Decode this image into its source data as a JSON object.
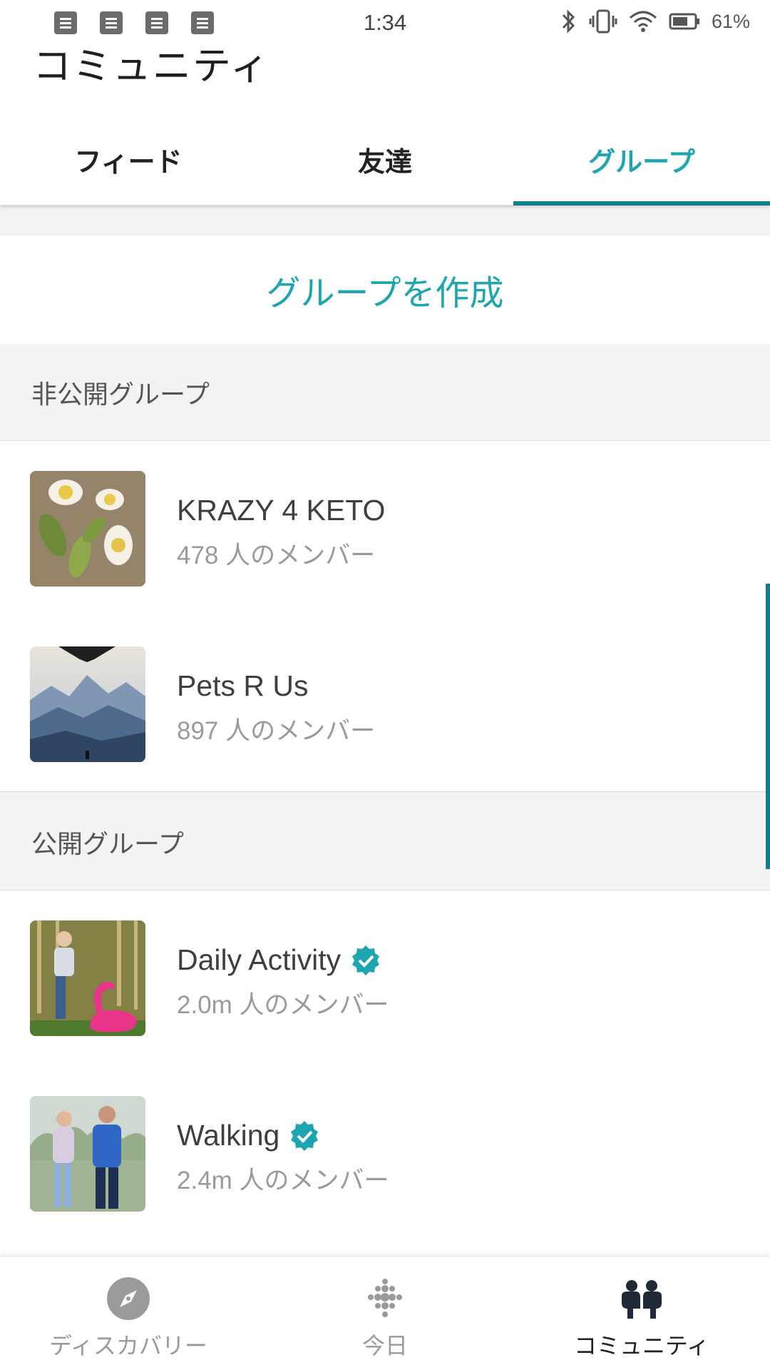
{
  "status_bar": {
    "time": "1:34",
    "battery_percent": "61%",
    "notification_icons": [
      "notification-icon",
      "notification-icon",
      "notification-icon",
      "notification-icon"
    ],
    "system_icons": [
      "bluetooth-icon",
      "vibrate-icon",
      "wifi-icon",
      "battery-icon"
    ]
  },
  "header": {
    "title": "コミュニティ"
  },
  "tabs": [
    {
      "label": "フィード",
      "active": false
    },
    {
      "label": "友達",
      "active": false
    },
    {
      "label": "グループ",
      "active": true
    }
  ],
  "create_group": {
    "label": "グループを作成"
  },
  "private_groups": {
    "header": "非公開グループ",
    "items": [
      {
        "name": "KRAZY 4 KETO",
        "members": "478 人のメンバー",
        "verified": false,
        "thumb": "food-photo"
      },
      {
        "name": "Pets R Us",
        "members": "897 人のメンバー",
        "verified": false,
        "thumb": "mountain-photo"
      }
    ]
  },
  "public_groups": {
    "header": "公開グループ",
    "items": [
      {
        "name": "Daily Activity",
        "members": "2.0m 人のメンバー",
        "verified": true,
        "thumb": "yoga-flamingo-photo"
      },
      {
        "name": "Walking",
        "members": "2.4m 人のメンバー",
        "verified": true,
        "thumb": "walking-couple-photo"
      }
    ]
  },
  "bottom_nav": [
    {
      "label": "ディスカバリー",
      "icon": "compass-icon",
      "active": false
    },
    {
      "label": "今日",
      "icon": "fitbit-dots-icon",
      "active": false
    },
    {
      "label": "コミュニティ",
      "icon": "community-icon",
      "active": true
    }
  ],
  "colors": {
    "accent": "#1ea6b0",
    "tab_underline": "#0e7f8c",
    "section_bg": "#f3f3f3"
  }
}
